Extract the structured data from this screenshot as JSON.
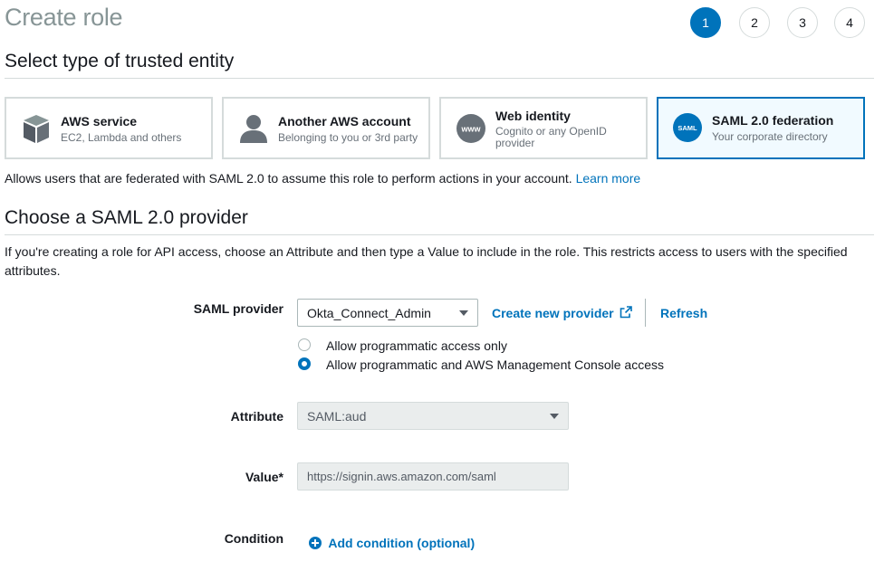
{
  "page": {
    "title": "Create role"
  },
  "steps": [
    "1",
    "2",
    "3",
    "4"
  ],
  "trusted_entity": {
    "heading": "Select type of trusted entity",
    "cards": [
      {
        "title": "AWS service",
        "subtitle": "EC2, Lambda and others",
        "icon": "box-icon"
      },
      {
        "title": "Another AWS account",
        "subtitle": "Belonging to you or 3rd party",
        "icon": "user-icon"
      },
      {
        "title": "Web identity",
        "subtitle": "Cognito or any OpenID provider",
        "icon": "www-icon",
        "icon_text": "www"
      },
      {
        "title": "SAML 2.0 federation",
        "subtitle": "Your corporate directory",
        "icon": "saml-icon",
        "icon_text": "SAML"
      }
    ],
    "selected_card": "SAML 2.0 federation",
    "description": "Allows users that are federated with SAML 2.0 to assume this role to perform actions in your account.",
    "learn_more": "Learn more"
  },
  "provider_section": {
    "heading": "Choose a SAML 2.0 provider",
    "description": "If you're creating a role for API access, choose an Attribute and then type a Value to include in the role. This restricts access to users with the specified attributes."
  },
  "form": {
    "saml_provider": {
      "label": "SAML provider",
      "value": "Okta_Connect_Admin",
      "create_link": "Create new provider",
      "refresh": "Refresh"
    },
    "access_options": [
      {
        "label": "Allow programmatic access only",
        "selected": false
      },
      {
        "label": "Allow programmatic and AWS Management Console access",
        "selected": true
      }
    ],
    "attribute": {
      "label": "Attribute",
      "value": "SAML:aud"
    },
    "value": {
      "label": "Value*",
      "value": "https://signin.aws.amazon.com/saml"
    },
    "condition": {
      "label": "Condition",
      "add_label": "Add condition (optional)"
    }
  },
  "colors": {
    "accent": "#0073bb",
    "selected_bg": "#f1faff",
    "muted_title": "#879596",
    "border": "#d5dbdb"
  }
}
